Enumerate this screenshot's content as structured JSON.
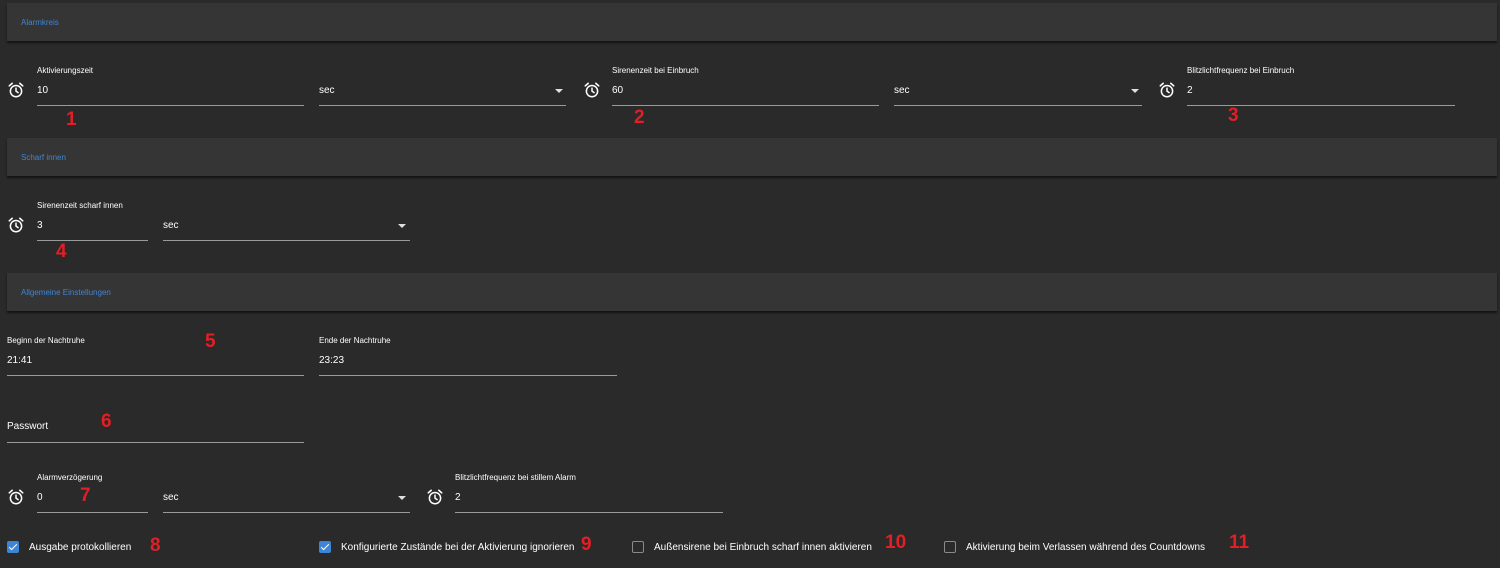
{
  "sections": {
    "alarmkreis": "Alarmkreis",
    "scharf_innen": "Scharf innen",
    "allgemeine": "Allgemeine Einstellungen"
  },
  "fields": {
    "aktivierungszeit": {
      "label": "Aktivierungszeit",
      "value": "10",
      "unit": "sec"
    },
    "sirenenzeit_einbruch": {
      "label": "Sirenenzeit bei Einbruch",
      "value": "60",
      "unit": "sec"
    },
    "blitzlicht_einbruch": {
      "label": "Blitzlichtfrequenz bei Einbruch",
      "value": "2"
    },
    "sirenenzeit_scharf_innen": {
      "label": "Sirenenzeit scharf innen",
      "value": "3",
      "unit": "sec"
    },
    "beginn_nachtruhe": {
      "label": "Beginn der Nachtruhe",
      "value": "21:41"
    },
    "ende_nachtruhe": {
      "label": "Ende der Nachtruhe",
      "value": "23:23"
    },
    "passwort": {
      "placeholder": "Passwort"
    },
    "alarmverzoegerung": {
      "label": "Alarmverzögerung",
      "value": "0",
      "unit": "sec"
    },
    "blitzlicht_stiller_alarm": {
      "label": "Blitzlichtfrequenz bei stillem Alarm",
      "value": "2"
    }
  },
  "checkboxes": [
    {
      "label": "Ausgabe protokollieren",
      "checked": true
    },
    {
      "label": "Konfigurierte Zustände bei der Aktivierung ignorieren",
      "checked": true
    },
    {
      "label": "Außensirene bei Einbruch scharf innen aktivieren",
      "checked": false
    },
    {
      "label": "Aktivierung beim Verlassen während des Countdowns",
      "checked": false
    }
  ],
  "annotations": [
    "1",
    "2",
    "3",
    "4",
    "5",
    "6",
    "7",
    "8",
    "9",
    "10",
    "11"
  ],
  "colors": {
    "background": "#2a2a2a",
    "section_header": "#353535",
    "accent_blue": "#3d85d6",
    "annotation_red": "#e31e24",
    "underline": "#9a9a9a"
  }
}
